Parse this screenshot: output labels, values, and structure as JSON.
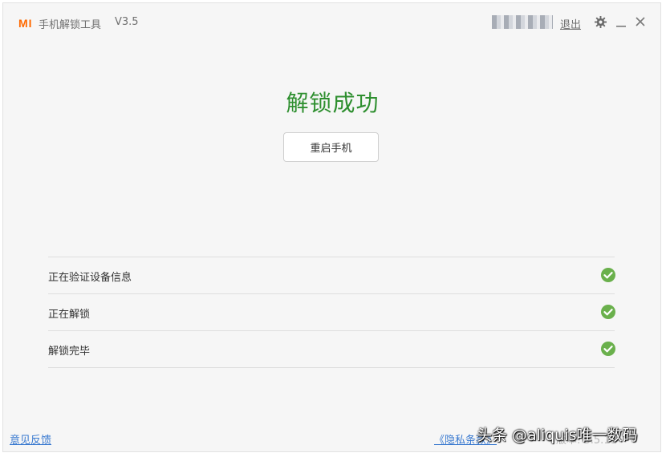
{
  "header": {
    "logo_text": "MI",
    "app_title": "手机解锁工具",
    "version": "V3.5",
    "logout_label": "退出",
    "icons": [
      "gear-icon",
      "minimize-icon",
      "close-icon"
    ]
  },
  "main": {
    "headline": "解锁成功",
    "reboot_label": "重启手机",
    "steps": [
      {
        "label": "正在验证设备信息",
        "status": "done"
      },
      {
        "label": "正在解锁",
        "status": "done"
      },
      {
        "label": "解锁完毕",
        "status": "done"
      }
    ]
  },
  "footer": {
    "feedback_label": "意见反馈",
    "privacy_label": "《隐私条款》",
    "build_label": "版本: 3.5.11"
  },
  "watermark": "头条 @aliquis唯一数码",
  "colors": {
    "brand": "#ff6900",
    "success": "#2e8f2f",
    "check": "#6ab04c",
    "link": "#3a7ad0"
  }
}
